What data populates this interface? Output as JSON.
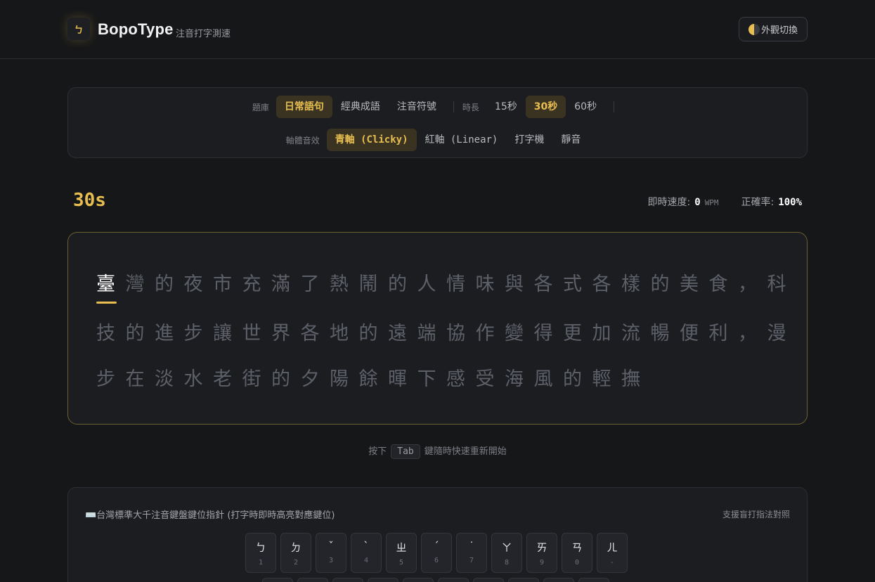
{
  "header": {
    "logo_glyph": "ㄅ",
    "brand": "BopoType",
    "subtitle": "注音打字測速",
    "theme_button": "外觀切換"
  },
  "settings": {
    "bank_label": "題庫",
    "banks": [
      "日常語句",
      "經典成語",
      "注音符號"
    ],
    "bank_active": 0,
    "duration_label": "時長",
    "durations": [
      "15秒",
      "30秒",
      "60秒"
    ],
    "duration_active": 1,
    "sound_label": "軸體音效",
    "sounds": [
      "青軸 (Clicky)",
      "紅軸 (Linear)",
      "打字機",
      "靜音"
    ],
    "sound_active": 0
  },
  "stats": {
    "timer": "30s",
    "speed_label": "即時速度:",
    "speed_value": "0",
    "speed_unit": "WPM",
    "accuracy_label": "正確率:",
    "accuracy_value": "100%"
  },
  "text": {
    "current_char": "臺",
    "line1_rest": "灣的夜市充滿了熱鬧的人情味與各式各樣的美食，科",
    "line2": "技的進步讓世界各地的遠端協作變得更加流暢便利，漫",
    "line3": "步在淡水老街的夕陽餘暉下感受海風的輕撫"
  },
  "hint": {
    "before": "按下",
    "key": "Tab",
    "after": "鍵隨時快速重新開始"
  },
  "keyboard": {
    "title": "⌨️台灣標準大千注音鍵盤鍵位指針 (打字時即時高亮對應鍵位)",
    "note": "支援盲打指法對照",
    "row1": [
      {
        "zhuyin": "ㄅ",
        "key": "1"
      },
      {
        "zhuyin": "ㄉ",
        "key": "2"
      },
      {
        "zhuyin": "ˇ",
        "key": "3"
      },
      {
        "zhuyin": "ˋ",
        "key": "4"
      },
      {
        "zhuyin": "ㄓ",
        "key": "5"
      },
      {
        "zhuyin": "ˊ",
        "key": "6"
      },
      {
        "zhuyin": "˙",
        "key": "7"
      },
      {
        "zhuyin": "ㄚ",
        "key": "8"
      },
      {
        "zhuyin": "ㄞ",
        "key": "9"
      },
      {
        "zhuyin": "ㄢ",
        "key": "0"
      },
      {
        "zhuyin": "ㄦ",
        "key": "-"
      }
    ]
  }
}
